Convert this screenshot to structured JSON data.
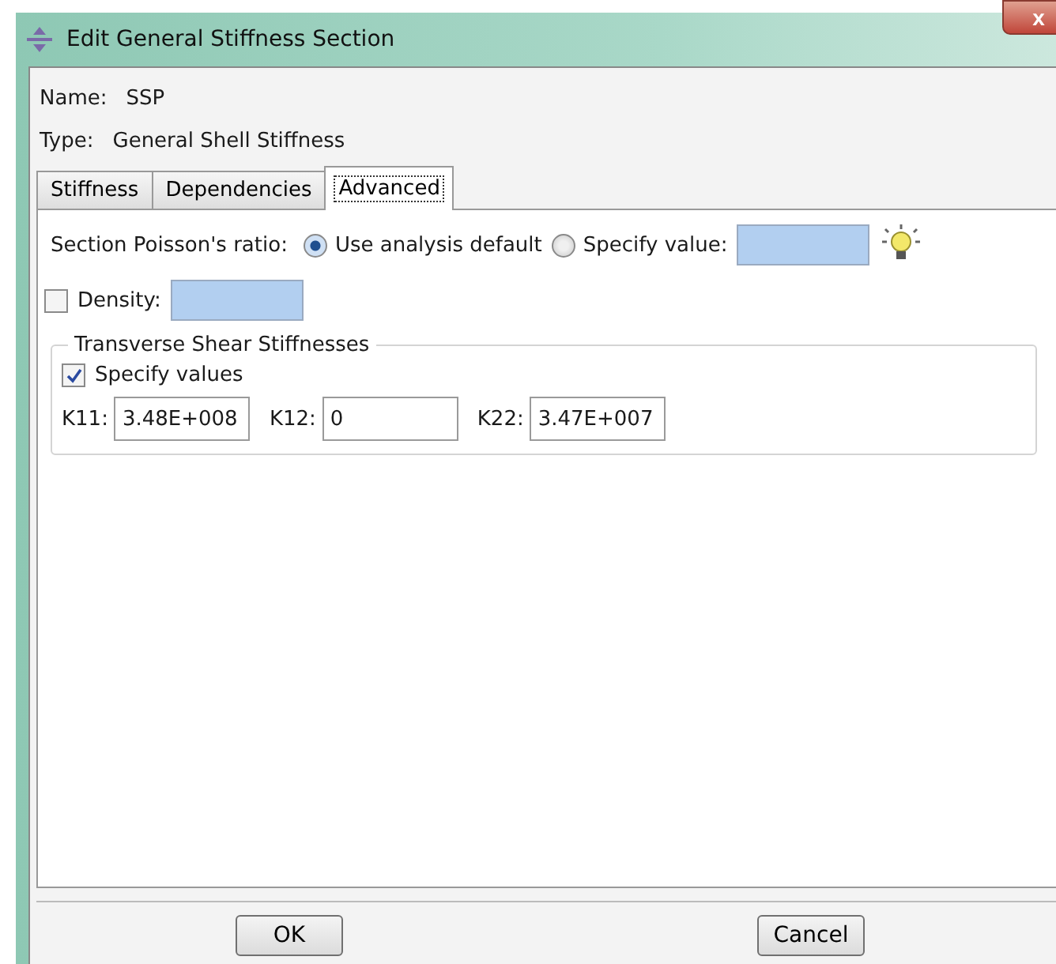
{
  "window": {
    "title": "Edit General Stiffness Section",
    "close": "x"
  },
  "name": {
    "label": "Name:",
    "value": "SSP"
  },
  "type": {
    "label": "Type:",
    "value": "General Shell Stiffness"
  },
  "tabs": [
    {
      "label": "Stiffness",
      "selected": false
    },
    {
      "label": "Dependencies",
      "selected": false
    },
    {
      "label": "Advanced",
      "selected": true
    }
  ],
  "poisson": {
    "label": "Section Poisson's ratio:",
    "options": [
      {
        "label": "Use analysis default",
        "selected": true
      },
      {
        "label": "Specify value:",
        "selected": false
      }
    ]
  },
  "density": {
    "label": "Density:",
    "checked": false
  },
  "shear": {
    "title": "Transverse Shear Stiffnesses",
    "specify": {
      "label": "Specify values",
      "checked": true
    },
    "fields": [
      {
        "label": "K11:",
        "value": "3.48E+008"
      },
      {
        "label": "K12:",
        "value": "0"
      },
      {
        "label": "K22:",
        "value": "3.47E+007"
      }
    ]
  },
  "buttons": [
    "OK",
    "Cancel"
  ]
}
